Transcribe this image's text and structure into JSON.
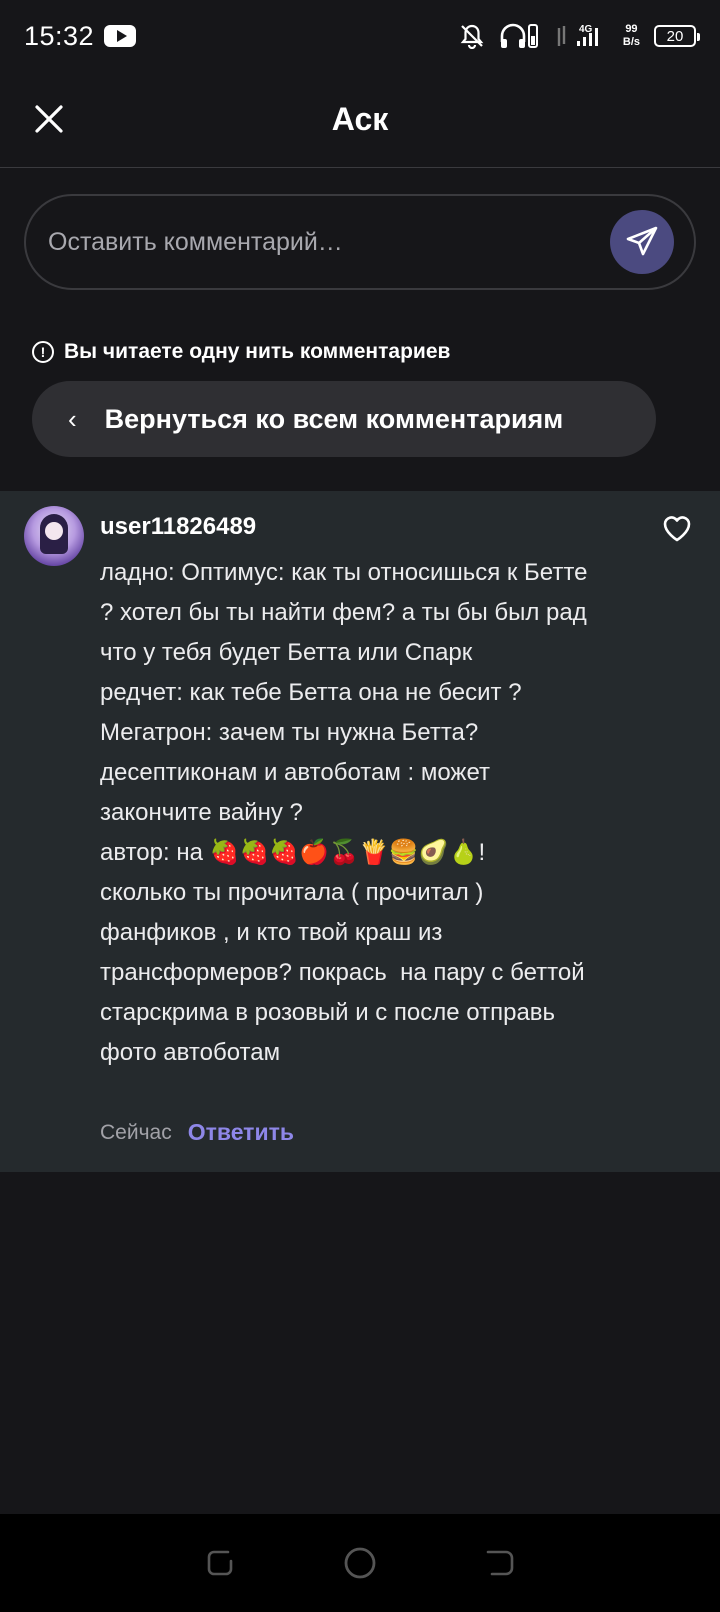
{
  "status_bar": {
    "time": "15:32",
    "network_type": "4G",
    "net_speed_value": "99",
    "net_speed_unit": "B/s",
    "battery": "20"
  },
  "header": {
    "title": "Аск"
  },
  "comment_input": {
    "placeholder": "Оставить комментарий…"
  },
  "thread": {
    "notice": "Вы читаете одну нить комментариев",
    "back_label": "Вернуться ко всем комментариям"
  },
  "comment": {
    "username": "user11826489",
    "text": "ладно: Оптимус: как ты относишься к Бетте ? хотел бы ты найти фем? а ты бы был рад что у тебя будет Бетта или Спарк\nредчет: как тебе Бетта она не бесит ?\nМегатрон: зачем ты нужна Бетта?\nдесептиконам и автоботам : может закончите вайну ?\nавтор: на 🍓🍓🍓🍎🍒🍟🍔🥑🍐!\nсколько ты прочитала ( прочитал ) фанфиков , и кто твой краш из трансформеров? покрась  на пару с беттой старскрима в розовый и с после отправь фото автоботам",
    "timestamp": "Сейчас",
    "reply_label": "Ответить"
  },
  "colors": {
    "background": "#161619",
    "card": "#252a2d",
    "accent": "#8e87e8",
    "send_button": "#4b4a80"
  },
  "icons": [
    "youtube-icon",
    "notifications-off-icon",
    "headphones-icon",
    "signal-icon",
    "close-icon",
    "send-icon",
    "info-icon",
    "chevron-left-icon",
    "heart-icon",
    "recents-icon",
    "home-icon",
    "back-icon"
  ]
}
